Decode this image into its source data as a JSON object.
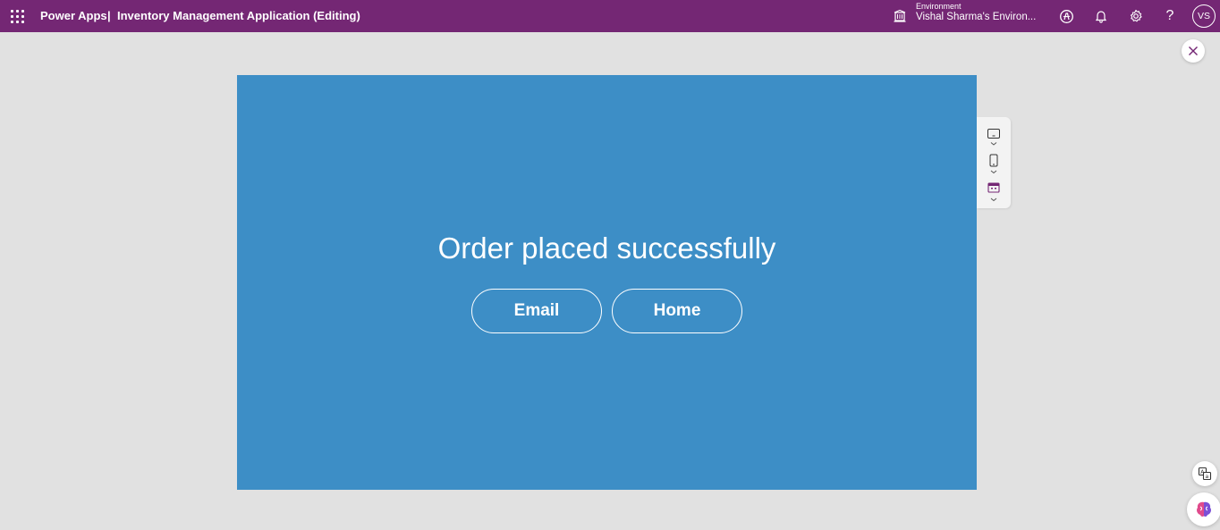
{
  "topbar": {
    "brand": "Power Apps",
    "separator": "|",
    "app_title": "Inventory Management Application (Editing)",
    "environment_label": "Environment",
    "environment_name": "Vishal Sharma's Environ...",
    "avatar_initials": "VS",
    "help_glyph": "?"
  },
  "screen": {
    "headline": "Order placed successfully",
    "email_button": "Email",
    "home_button": "Home",
    "background_color": "#3d8ec6"
  },
  "colors": {
    "topbar": "#742774",
    "accent": "#742774",
    "page_bg": "#e1e1e1"
  },
  "icons": {
    "waffle": "app-launcher-icon",
    "environment": "environment-icon",
    "copilot": "copilot-icon",
    "notifications": "bell-icon",
    "settings": "gear-icon",
    "help": "help-icon",
    "close": "close-icon",
    "tablet": "tablet-layout-icon",
    "phone": "phone-layout-icon",
    "calendar": "calendar-icon",
    "translate": "translate-icon",
    "brain": "brain-icon"
  }
}
